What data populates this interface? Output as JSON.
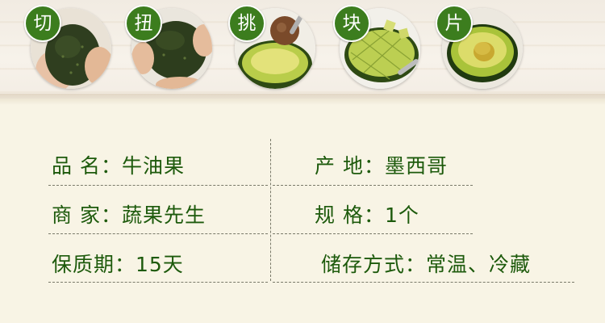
{
  "steps": [
    {
      "label": "切",
      "icon": "avocado-whole-icon"
    },
    {
      "label": "扭",
      "icon": "avocado-twist-icon"
    },
    {
      "label": "挑",
      "icon": "avocado-pit-icon"
    },
    {
      "label": "块",
      "icon": "avocado-cubes-icon"
    },
    {
      "label": "片",
      "icon": "avocado-half-icon"
    }
  ],
  "product_info": {
    "name": "品 名：牛油果",
    "origin": "产 地：墨西哥",
    "merchant": "商 家：蔬果先生",
    "spec": "规 格：1个",
    "shelf_life": "保质期：15天",
    "storage": "储存方式：常温、冷藏"
  },
  "colors": {
    "brand_green": "#3c7d1e",
    "text_green": "#1d5a0c",
    "background": "#f8f4e5"
  }
}
